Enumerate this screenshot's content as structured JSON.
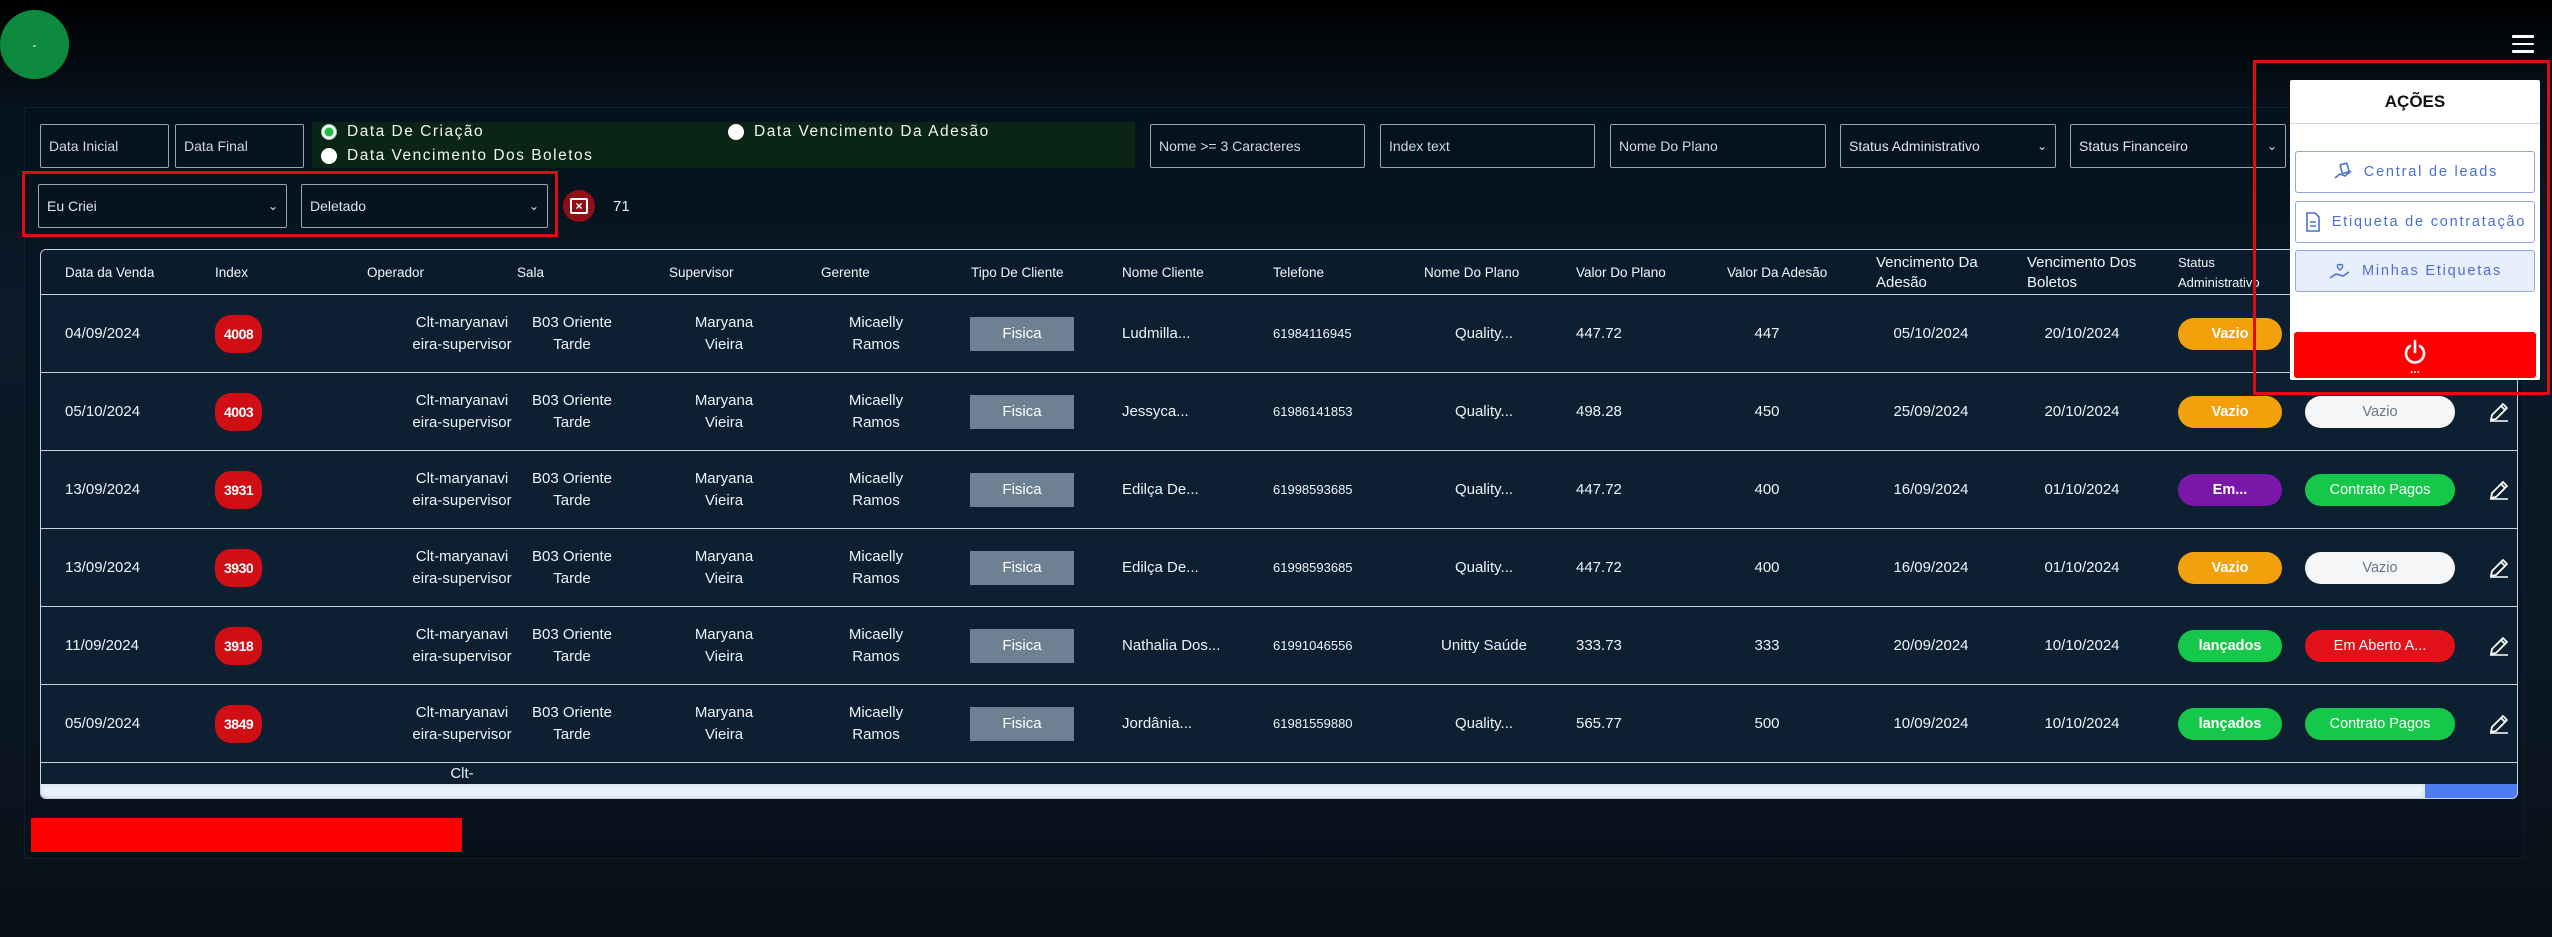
{
  "avatar": {
    "label": "-"
  },
  "filters": {
    "data_inicial": "Data Inicial",
    "data_final": "Data Final",
    "radio_options": [
      {
        "label": "Data De Criação",
        "checked": true
      },
      {
        "label": "Data Vencimento Dos Boletos",
        "checked": false
      },
      {
        "label": "Data Vencimento Da Adesão",
        "checked": false
      }
    ],
    "nome_placeholder": "Nome >= 3 Caracteres",
    "index_placeholder": "Index text",
    "plano_placeholder": "Nome Do Plano",
    "status_admin": "Status Administrativo",
    "status_fin": "Status Financeiro",
    "eu_criei": "Eu Criei",
    "deletado": "Deletado",
    "count": "71"
  },
  "table": {
    "headers": [
      "Data da Venda",
      "Index",
      "Operador",
      "Sala",
      "Supervisor",
      "Gerente",
      "Tipo De Cliente",
      "Nome Cliente",
      "Telefone",
      "Nome Do Plano",
      "Valor Do Plano",
      "Valor Da Adesão",
      "Vencimento Da Adesão",
      "Vencimento Dos Boletos",
      "Status Administrativo"
    ],
    "rows": [
      {
        "data": "04/09/2024",
        "index": "4008",
        "operador": "Clt-maryanavieira-supervisor",
        "sala": "B03 Oriente Tarde",
        "supervisor": "Maryana Vieira",
        "gerente": "Micaelly Ramos",
        "tipo": "Fisica",
        "cliente": "Ludmilla...",
        "telefone": "61984116945",
        "plano": "Quality...",
        "valor_plano": "447.72",
        "valor_adesao": "447",
        "venc_adesao": "05/10/2024",
        "venc_boletos": "20/10/2024",
        "status_admin": "Vazio",
        "status_fin": "",
        "admin_color": "#f2a10c",
        "fin_style": "none"
      },
      {
        "data": "05/10/2024",
        "index": "4003",
        "operador": "Clt-maryanavieira-supervisor",
        "sala": "B03 Oriente Tarde",
        "supervisor": "Maryana Vieira",
        "gerente": "Micaelly Ramos",
        "tipo": "Fisica",
        "cliente": "Jessyca...",
        "telefone": "61986141853",
        "plano": "Quality...",
        "valor_plano": "498.28",
        "valor_adesao": "450",
        "venc_adesao": "25/09/2024",
        "venc_boletos": "20/10/2024",
        "status_admin": "Vazio",
        "status_fin": "Vazio",
        "admin_color": "#f2a10c",
        "fin_style": "white"
      },
      {
        "data": "13/09/2024",
        "index": "3931",
        "operador": "Clt-maryanavieira-supervisor",
        "sala": "B03 Oriente Tarde",
        "supervisor": "Maryana Vieira",
        "gerente": "Micaelly Ramos",
        "tipo": "Fisica",
        "cliente": "Edilça De...",
        "telefone": "61998593685",
        "plano": "Quality...",
        "valor_plano": "447.72",
        "valor_adesao": "400",
        "venc_adesao": "16/09/2024",
        "venc_boletos": "01/10/2024",
        "status_admin": "Em...",
        "status_fin": "Contrato Pagos",
        "admin_color": "#7a17a8",
        "fin_style": "green"
      },
      {
        "data": "13/09/2024",
        "index": "3930",
        "operador": "Clt-maryanavieira-supervisor",
        "sala": "B03 Oriente Tarde",
        "supervisor": "Maryana Vieira",
        "gerente": "Micaelly Ramos",
        "tipo": "Fisica",
        "cliente": "Edilça De...",
        "telefone": "61998593685",
        "plano": "Quality...",
        "valor_plano": "447.72",
        "valor_adesao": "400",
        "venc_adesao": "16/09/2024",
        "venc_boletos": "01/10/2024",
        "status_admin": "Vazio",
        "status_fin": "Vazio",
        "admin_color": "#f2a10c",
        "fin_style": "white"
      },
      {
        "data": "11/09/2024",
        "index": "3918",
        "operador": "Clt-maryanavieira-supervisor",
        "sala": "B03 Oriente Tarde",
        "supervisor": "Maryana Vieira",
        "gerente": "Micaelly Ramos",
        "tipo": "Fisica",
        "cliente": "Nathalia Dos...",
        "telefone": "61991046556",
        "plano": "Unitty Saúde",
        "valor_plano": "333.73",
        "valor_adesao": "333",
        "venc_adesao": "20/09/2024",
        "venc_boletos": "10/10/2024",
        "status_admin": "lançados",
        "status_fin": "Em Aberto A...",
        "admin_color": "#16c84a",
        "fin_style": "red"
      },
      {
        "data": "05/09/2024",
        "index": "3849",
        "operador": "Clt-maryanavieira-supervisor",
        "sala": "B03 Oriente Tarde",
        "supervisor": "Maryana Vieira",
        "gerente": "Micaelly Ramos",
        "tipo": "Fisica",
        "cliente": "Jordânia...",
        "telefone": "61981559880",
        "plano": "Quality...",
        "valor_plano": "565.77",
        "valor_adesao": "500",
        "venc_adesao": "10/09/2024",
        "venc_boletos": "10/10/2024",
        "status_admin": "lançados",
        "status_fin": "Contrato Pagos",
        "admin_color": "#16c84a",
        "fin_style": "green"
      }
    ],
    "partial_row_operador": "Clt-"
  },
  "actions": {
    "title": "AÇÕES",
    "buttons": [
      {
        "label": "Central de leads",
        "icon": "hand-cards-icon"
      },
      {
        "label": "Etiqueta de contratação",
        "icon": "document-icon"
      },
      {
        "label": "Minhas Etiquetas",
        "icon": "hand-heart-icon"
      }
    ],
    "logout_dots": "..."
  }
}
